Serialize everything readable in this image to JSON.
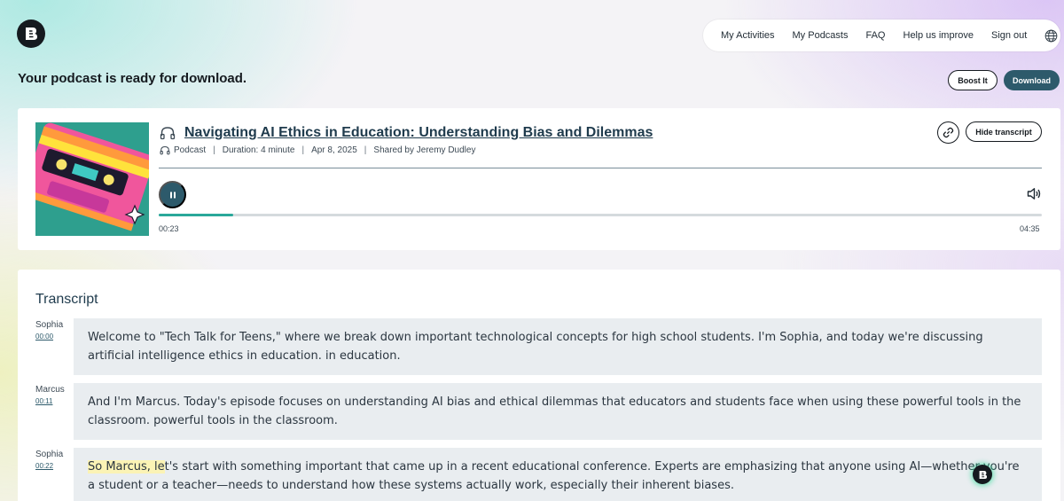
{
  "nav": {
    "items": [
      "My Activities",
      "My Podcasts",
      "FAQ",
      "Help us improve",
      "Sign out"
    ],
    "globe_icon": "globe-icon"
  },
  "banner": {
    "message": "Your podcast is ready for download.",
    "boost_label": "Boost It",
    "download_label": "Download"
  },
  "player": {
    "title": "Navigating AI Ethics in Education: Understanding Bias and Dilemmas",
    "type": "Podcast",
    "duration": "Duration: 4 minute",
    "date": "Apr 8, 2025",
    "shared_by": "Shared by Jeremy Dudley",
    "hide_transcript_label": "Hide transcript",
    "current_time": "00:23",
    "total_time": "04:35",
    "progress_fraction": 0.084,
    "accent_color": "#2d5a6b",
    "progress_color": "#2aa89a"
  },
  "transcript": {
    "heading": "Transcript",
    "segments": [
      {
        "speaker": "Sophia",
        "time": "00:00",
        "text": "Welcome to \"Tech Talk for Teens,\" where we break down important technological concepts for high school students. I'm Sophia, and today we're discussing artificial intelligence ethics in education. in education."
      },
      {
        "speaker": "Marcus",
        "time": "00:11",
        "text": "And I'm Marcus. Today's episode focuses on understanding AI bias and ethical dilemmas that educators and students face when using these powerful tools in the classroom. powerful tools in the classroom."
      },
      {
        "speaker": "Sophia",
        "time": "00:22",
        "text_highlight": "So Marcus, le",
        "text_rest": "t's start with something important that came up in a recent educational conference. Experts are emphasizing that anyone using AI—whether you're a student or a teacher—needs to understand how these systems actually work, especially their inherent biases."
      }
    ]
  }
}
